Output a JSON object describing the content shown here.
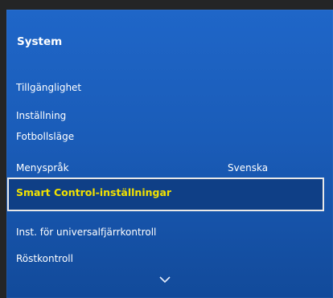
{
  "menu": {
    "title": "System",
    "items": [
      {
        "label": "Tillgänglighet"
      },
      {
        "label": "Inställning"
      },
      {
        "label": "Fotbollsläge"
      },
      {
        "label": "Menyspråk",
        "value": "Svenska"
      },
      {
        "label": "Smart Control-inställningar",
        "selected": true
      },
      {
        "label": "Inst. för universalfjärrkontroll"
      },
      {
        "label": "Röstkontroll"
      }
    ],
    "more_indicator_icon": "chevron-down-icon"
  },
  "colors": {
    "panel_top": "#1f66c8",
    "panel_bottom": "#124a9a",
    "selected_bg": "#0f3f86",
    "selected_text": "#f2e200",
    "text": "#ffffff"
  }
}
